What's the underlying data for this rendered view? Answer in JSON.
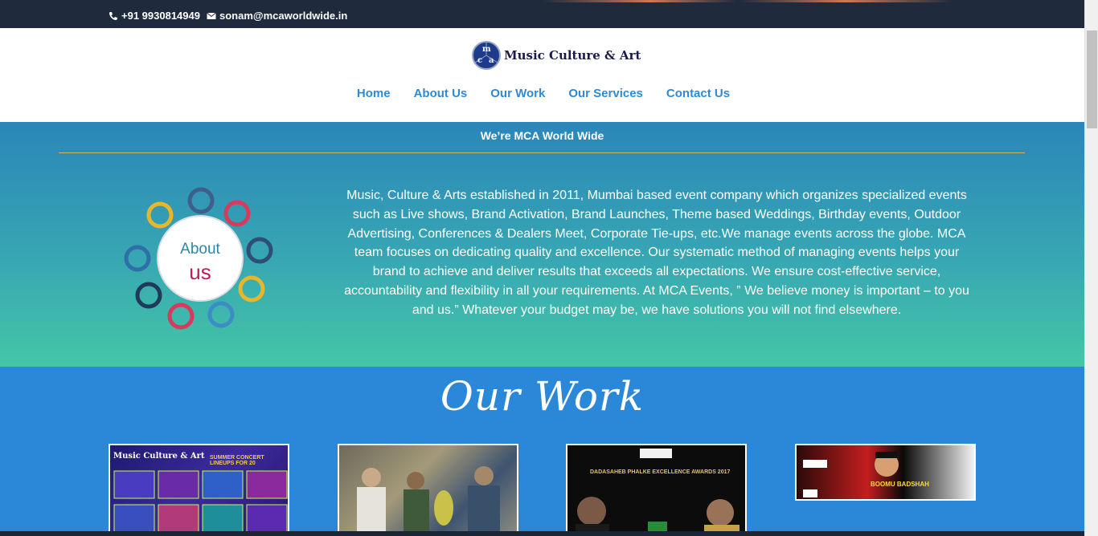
{
  "topbar": {
    "phone": "+91 9930814949",
    "email": "sonam@mcaworldwide.in"
  },
  "logo": {
    "letters": [
      "m",
      "c",
      "a"
    ],
    "text": "Music Culture & Art"
  },
  "nav": {
    "items": [
      "Home",
      "About Us",
      "Our Work",
      "Our Services",
      "Contact Us"
    ]
  },
  "about": {
    "heading": "We’re MCA World Wide",
    "badge_line1": "About",
    "badge_line2": "us",
    "body": "Music, Culture & Arts established in 2011, Mumbai based event company which organizes specialized events such as Live shows, Brand Activation, Brand Launches, Theme based Weddings, Birthday events, Outdoor Advertising, Conferences & Dealers Meet, Corporate Tie-ups, etc.We manage events across the globe. MCA team focuses on dedicating quality and excellence. Our systematic method of managing events helps your brand to achieve and deliver results that exceeds all expectations. We ensure cost-effective service, accountability and flexibility in all your requirements. At MCA Events, ” We believe money is important – to you and us.” Whatever your budget may be, we have solutions you will not find elsewhere."
  },
  "work": {
    "title": "Our Work",
    "cards": [
      {
        "caption": "Music Culture & Art",
        "sub": "SUMMER CONCERT LINEUPS FOR 20"
      },
      {
        "caption": ""
      },
      {
        "caption": "DADASAHEB PHALKE EXCELLENCE AWARDS 2017"
      },
      {
        "caption": "BOOMU BADSHAH"
      }
    ]
  },
  "colors": {
    "topbar": "#1f2a3c",
    "nav_link": "#2f8ad6",
    "about_top": "#2b86b9",
    "about_bottom": "#44c6a6",
    "work_bg": "#2b87d8",
    "rule": "#d4b46a"
  }
}
